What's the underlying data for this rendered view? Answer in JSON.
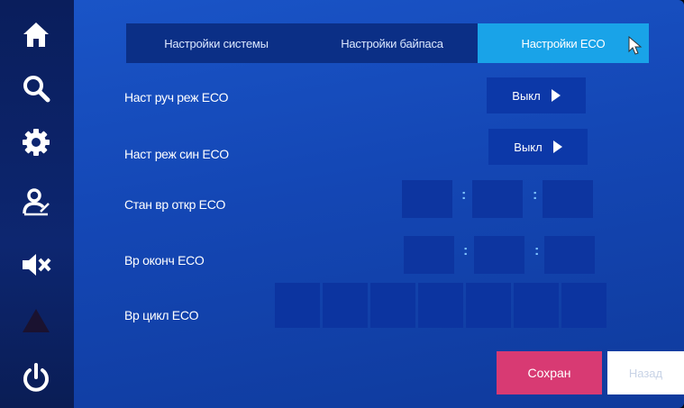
{
  "colors": {
    "accent_tab": "#19a3e8",
    "save_button": "#d83a73",
    "background": "#1447b5",
    "sidebar": "#0d2670"
  },
  "sidebar": {
    "items": [
      {
        "icon": "home-icon"
      },
      {
        "icon": "search-icon"
      },
      {
        "icon": "gear-icon"
      },
      {
        "icon": "user-edit-icon"
      },
      {
        "icon": "mute-icon"
      },
      {
        "icon": "warning-icon"
      },
      {
        "icon": "power-icon"
      }
    ]
  },
  "tabs": [
    {
      "label": "Настройки системы",
      "active": false
    },
    {
      "label": "Настройки байпаса",
      "active": false
    },
    {
      "label": "Настройки ECO",
      "active": true
    }
  ],
  "settings": {
    "manual_eco": {
      "label": "Наст руч реж ECO",
      "value": "Выкл"
    },
    "sync_eco": {
      "label": "Наст реж син ECO",
      "value": "Выкл"
    },
    "start_time": {
      "label": "Стан вр откр ECO",
      "separator": ":"
    },
    "end_time": {
      "label": "Вр оконч ECO",
      "separator": ":"
    },
    "cycle_time": {
      "label": "Вр цикл ECO"
    }
  },
  "buttons": {
    "save": "Сохран",
    "back": "Назад"
  }
}
